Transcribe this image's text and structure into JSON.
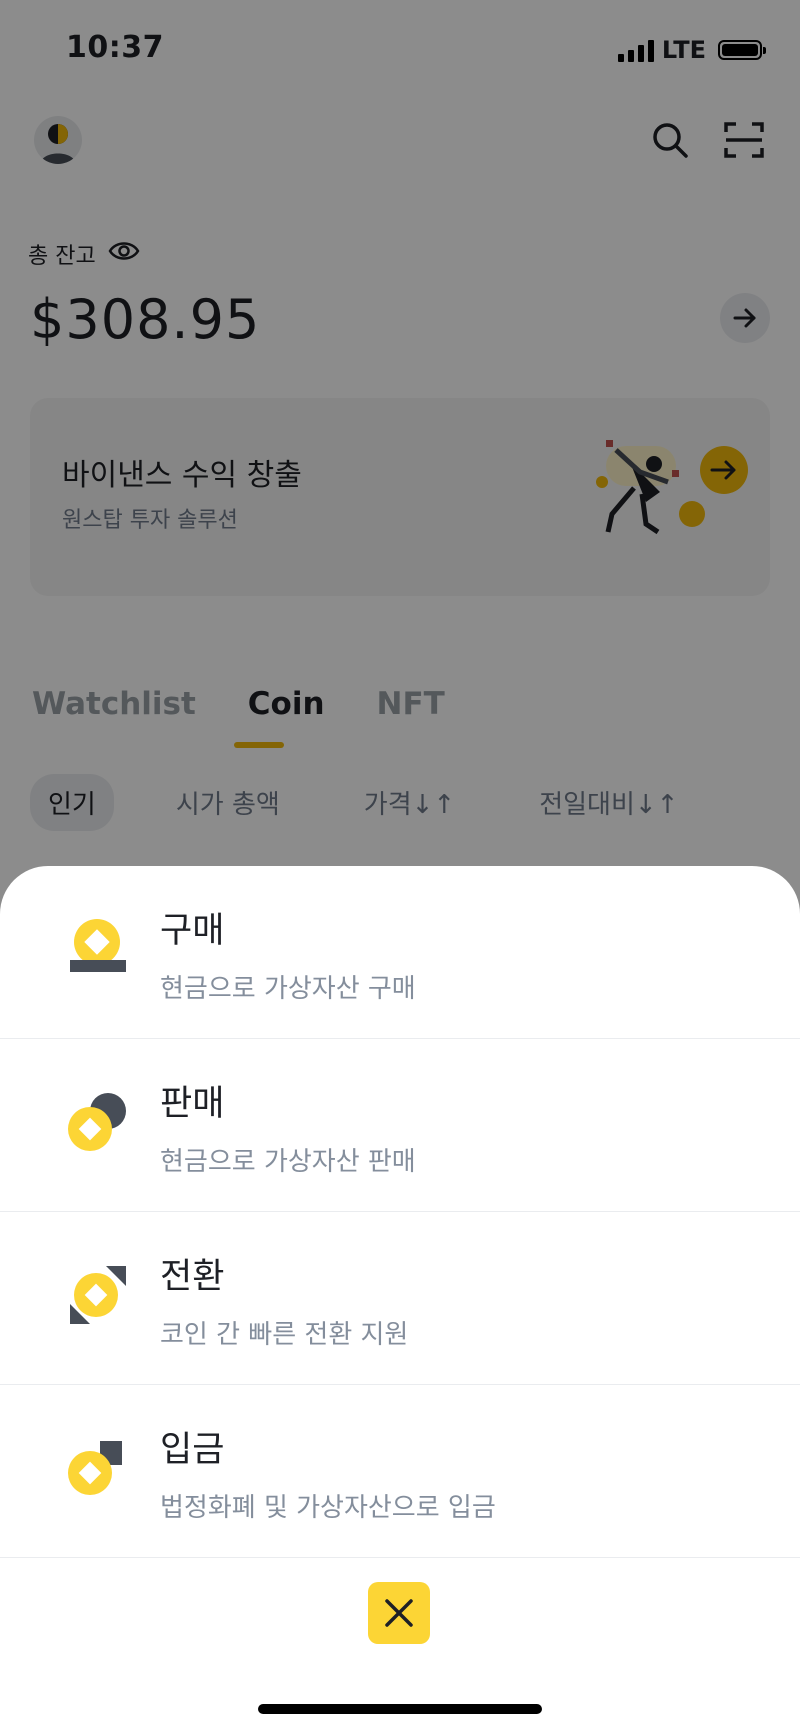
{
  "status": {
    "time": "10:37",
    "network": "LTE"
  },
  "header": {
    "avatar_icon": "user-avatar-icon",
    "search_icon": "search-icon",
    "scan_icon": "scan-icon"
  },
  "balance": {
    "label": "총 잔고",
    "visibility_icon": "eye-icon",
    "amount": "$308.95",
    "arrow_icon": "arrow-right-icon"
  },
  "promo": {
    "title": "바이낸스 수익 창출",
    "subtitle": "원스탑 투자 솔루션",
    "arrow_icon": "arrow-right-icon"
  },
  "tabs": {
    "items": [
      "Watchlist",
      "Coin",
      "NFT"
    ],
    "active": "Coin"
  },
  "filters": {
    "items": [
      "인기",
      "시가 총액",
      "가격↓↑",
      "전일대비↓↑"
    ],
    "active": "인기"
  },
  "sheet": {
    "options": [
      {
        "title": "구매",
        "subtitle": "현금으로 가상자산 구매",
        "icon": "buy-coin-icon"
      },
      {
        "title": "판매",
        "subtitle": "현금으로 가상자산 판매",
        "icon": "sell-coin-icon"
      },
      {
        "title": "전환",
        "subtitle": "코인 간 빠른 전환 지원",
        "icon": "convert-coin-icon"
      },
      {
        "title": "입금",
        "subtitle": "법정화폐 및 가상자산으로 입금",
        "icon": "deposit-coin-icon"
      }
    ],
    "close_icon": "close-icon"
  },
  "colors": {
    "brand_yellow": "#F0B90B",
    "coin_yellow": "#FCD535",
    "dark": "#1E2026",
    "muted": "#848E9C"
  }
}
